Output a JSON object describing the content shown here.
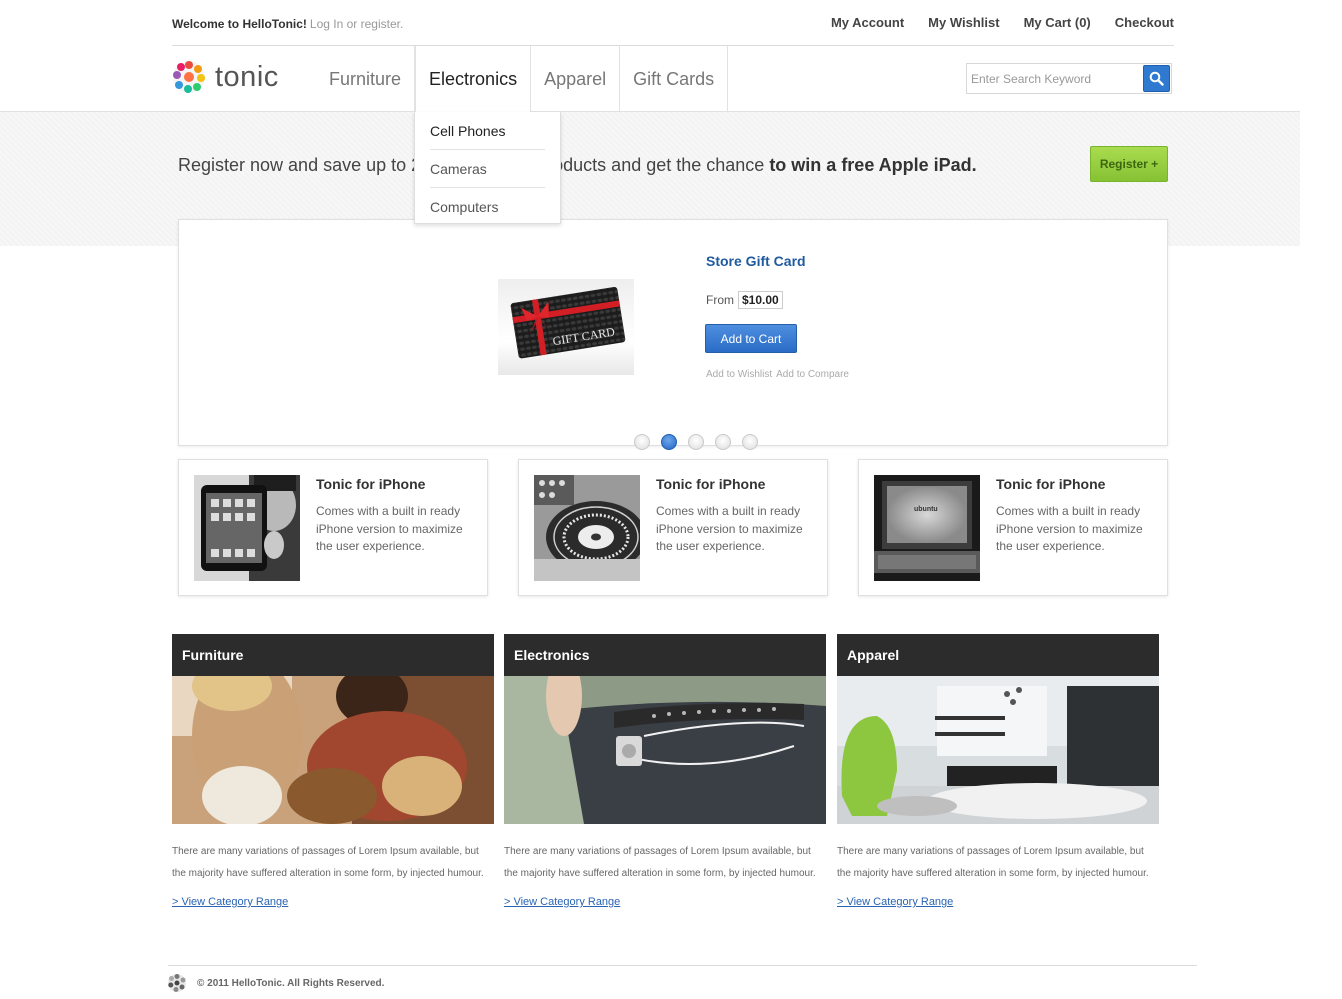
{
  "topbar": {
    "welcome": "Welcome to HelloTonic!",
    "login_text": "Log In or register.",
    "links": [
      "My Account",
      "My Wishlist",
      "My Cart (0)",
      "Checkout"
    ]
  },
  "header": {
    "logo_text": "tonic",
    "nav": [
      "Furniture",
      "Electronics",
      "Apparel",
      "Gift Cards"
    ],
    "search_placeholder": "Enter Search Keyword"
  },
  "dropdown": {
    "items": [
      "Cell Phones",
      "Cameras",
      "Computers"
    ]
  },
  "promo": {
    "text_start": "Register now and save up to 2",
    "text_mid": "roducts and get the chance ",
    "text_bold": "to win a free Apple iPad.",
    "register_label": "Register +"
  },
  "slider": {
    "product_title": "Store Gift Card",
    "image_text": "GIFT CARD",
    "price_label": "From",
    "price": "$10.00",
    "add_to_cart": "Add to Cart",
    "wishlist": "Add to Wishlist",
    "compare": "Add to Compare",
    "active_slide": 2,
    "slide_count": 5
  },
  "features": [
    {
      "title": "Tonic for iPhone",
      "text": "Comes with a built in ready iPhone version to maximize the user experience."
    },
    {
      "title": "Tonic for iPhone",
      "text": "Comes with a built in ready iPhone version to maximize the user experience."
    },
    {
      "title": "Tonic for iPhone",
      "text": "Comes with a built in ready iPhone version to maximize the user experience.",
      "screen_text": "ubuntu"
    }
  ],
  "categories": [
    {
      "title": "Furniture",
      "text": "There are many variations of passages of Lorem Ipsum available, but the majority have suffered alteration in some form, by injected humour.",
      "link": "> View Category Range"
    },
    {
      "title": "Electronics",
      "text": "There are many variations of passages of Lorem Ipsum available, but the majority have suffered alteration in some form, by injected humour.",
      "link": "> View Category Range"
    },
    {
      "title": "Apparel",
      "text": "There are many variations of passages of Lorem Ipsum available, but the majority have suffered alteration in some form, by injected humour.",
      "link": "> View Category Range"
    }
  ],
  "footer": {
    "copyright": "© 2011 HelloTonic. All Rights Reserved."
  },
  "colors": {
    "accent_blue": "#2f7ad0",
    "register_green": "#86c234",
    "link_blue": "#2a64b3"
  }
}
